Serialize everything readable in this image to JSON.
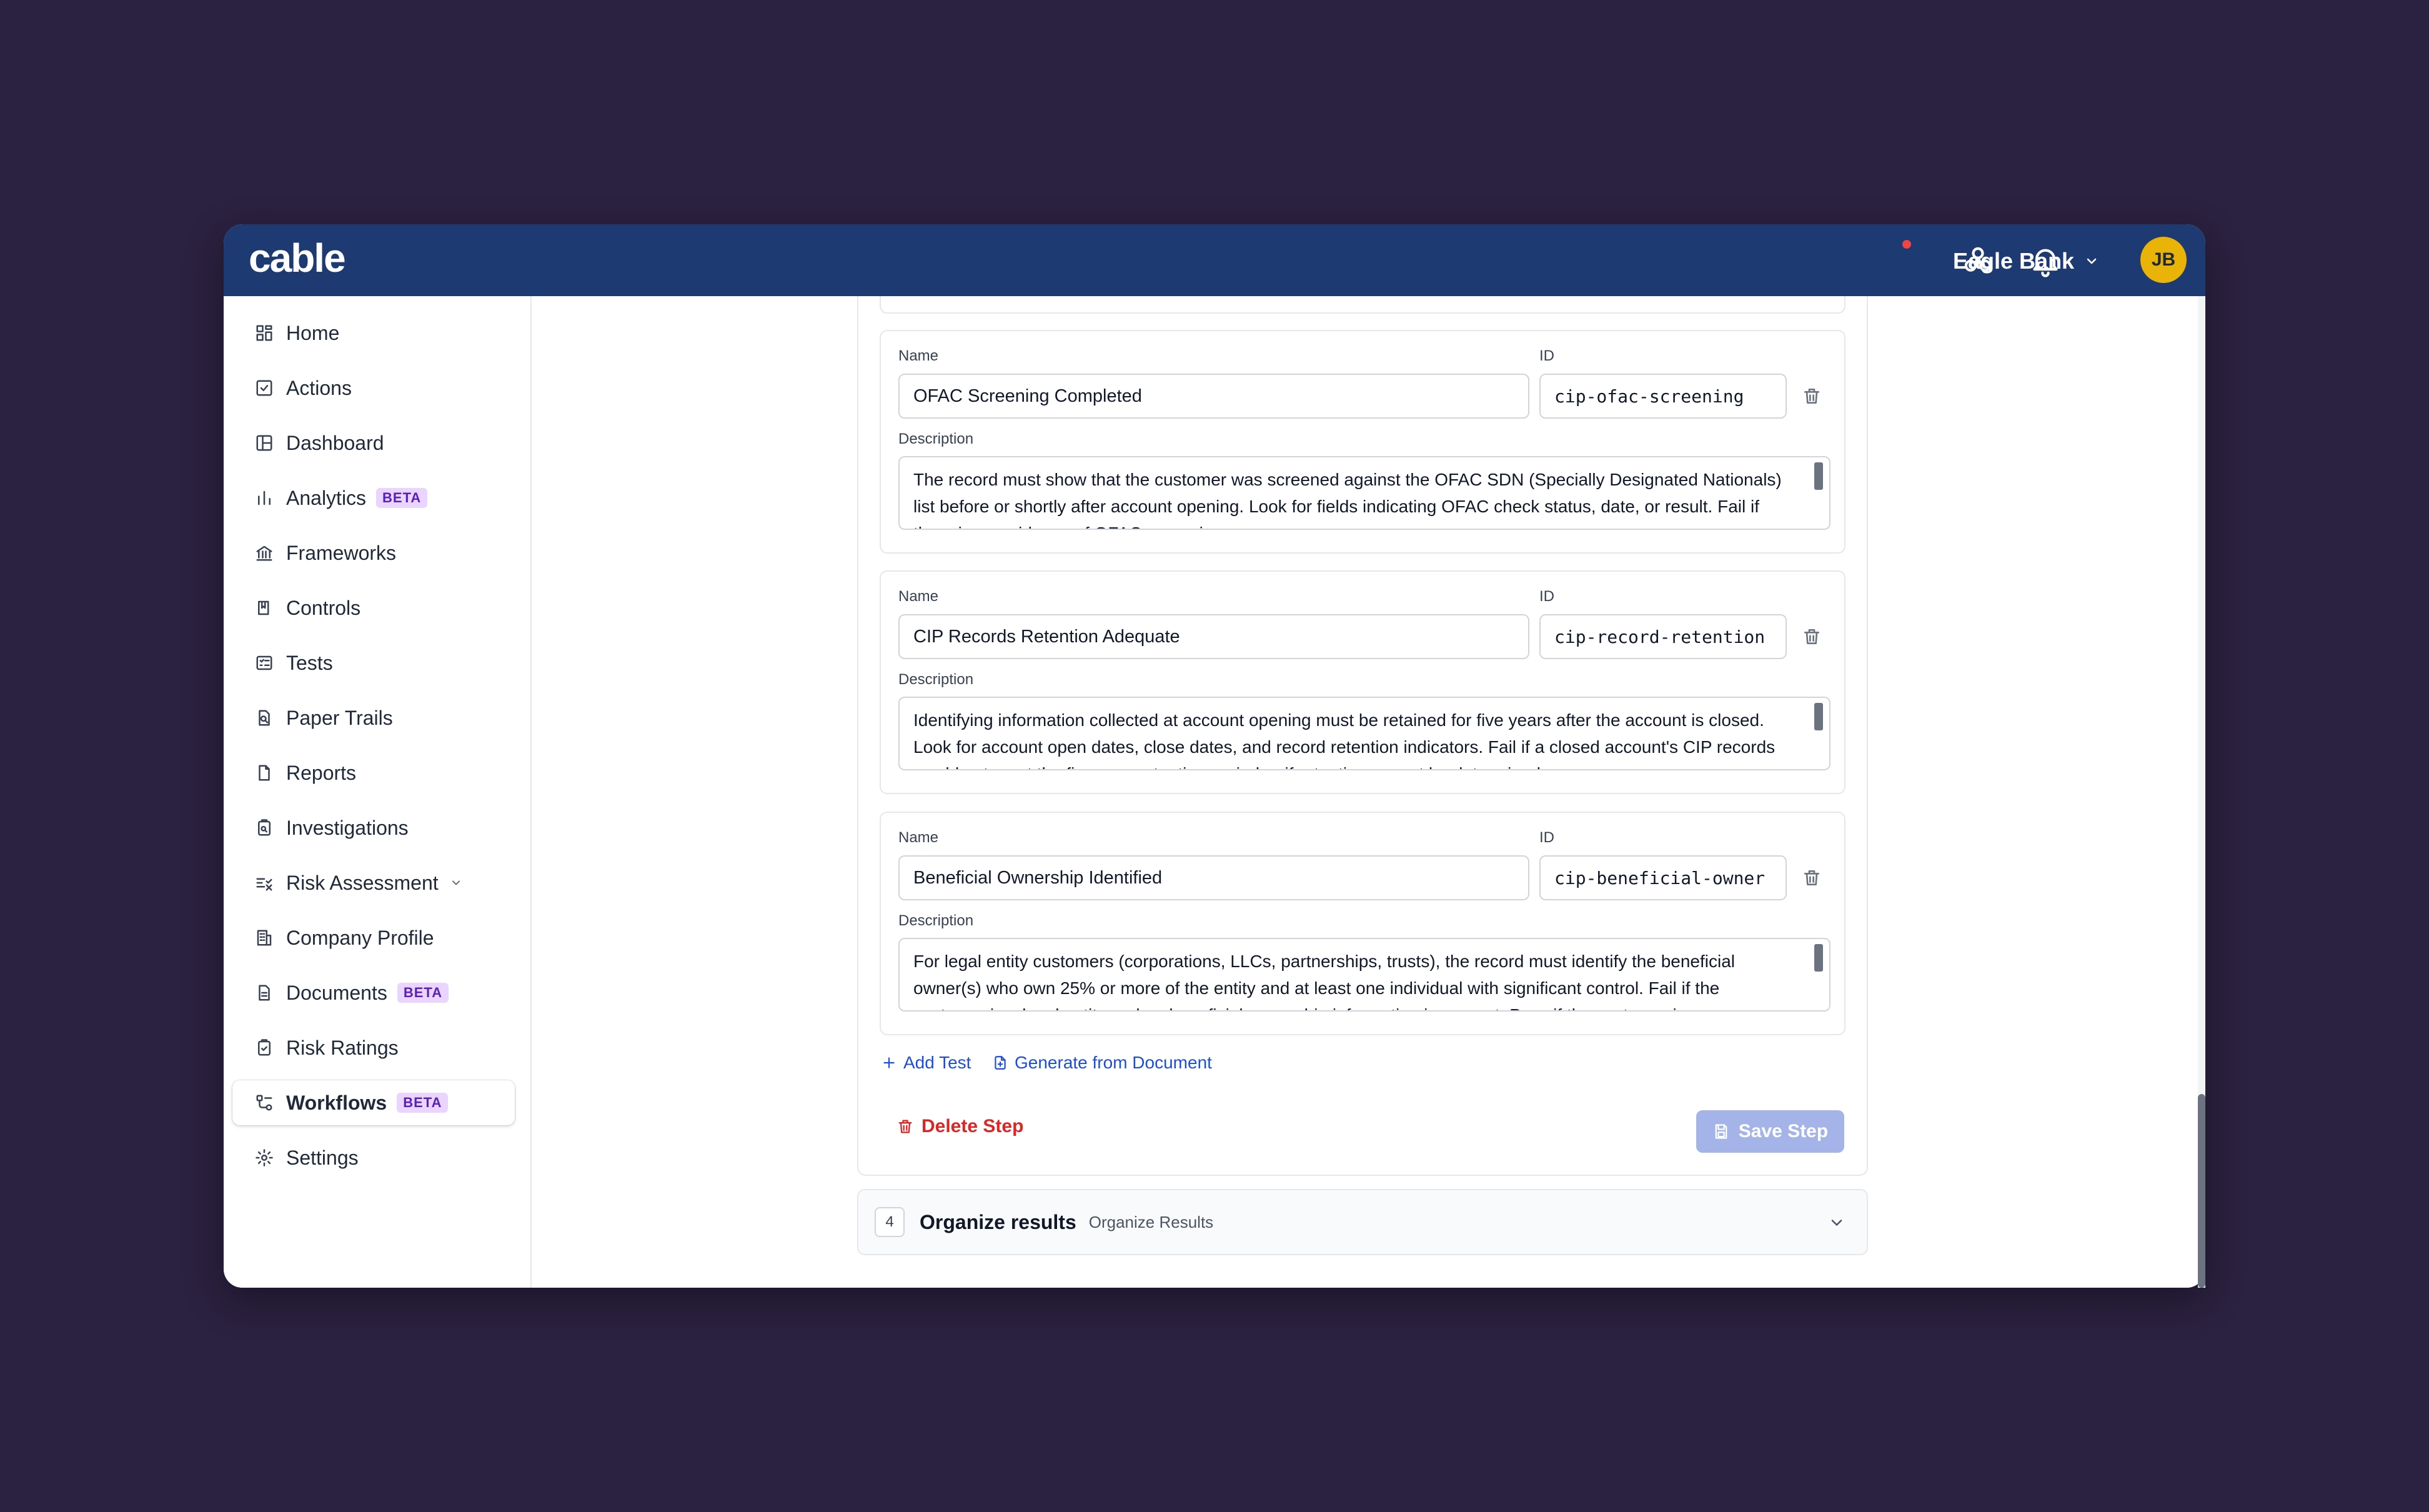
{
  "app": {
    "logo": "cable",
    "org_name": "Eagle Bank",
    "avatar_initials": "JB"
  },
  "sidebar": {
    "items": [
      {
        "label": "Home",
        "icon": "home-grid-icon"
      },
      {
        "label": "Actions",
        "icon": "checkbox-icon"
      },
      {
        "label": "Dashboard",
        "icon": "dashboard-icon"
      },
      {
        "label": "Analytics",
        "icon": "bar-chart-icon",
        "badge": "BETA"
      },
      {
        "label": "Frameworks",
        "icon": "bank-icon"
      },
      {
        "label": "Controls",
        "icon": "book-icon"
      },
      {
        "label": "Tests",
        "icon": "test-list-icon"
      },
      {
        "label": "Paper Trails",
        "icon": "file-search-icon"
      },
      {
        "label": "Reports",
        "icon": "file-icon"
      },
      {
        "label": "Investigations",
        "icon": "clipboard-search-icon"
      },
      {
        "label": "Risk Assessment",
        "icon": "list-check-icon"
      },
      {
        "label": "Company Profile",
        "icon": "building-icon"
      },
      {
        "label": "Documents",
        "icon": "document-icon",
        "badge": "BETA"
      },
      {
        "label": "Risk Ratings",
        "icon": "clipboard-check-icon"
      },
      {
        "label": "Workflows",
        "icon": "workflow-icon",
        "badge": "BETA",
        "active": true
      },
      {
        "label": "Settings",
        "icon": "gear-icon"
      }
    ]
  },
  "tests": [
    {
      "name_label": "Name",
      "name": "OFAC Screening Completed",
      "id_label": "ID",
      "id": "cip-ofac-screening",
      "description_label": "Description",
      "description": "The record must show that the customer was screened against the OFAC SDN (Specially Designated Nationals) list before or shortly after account opening. Look for fields indicating OFAC check status, date, or result. Fail if there is no evidence of OFAC screening."
    },
    {
      "name_label": "Name",
      "name": "CIP Records Retention Adequate",
      "id_label": "ID",
      "id": "cip-record-retention",
      "description_label": "Description",
      "description": "Identifying information collected at account opening must be retained for five years after the account is closed. Look for account open dates, close dates, and record retention indicators. Fail if a closed account's CIP records would not meet the five-year retention period or if retention cannot be determined."
    },
    {
      "name_label": "Name",
      "name": "Beneficial Ownership Identified",
      "id_label": "ID",
      "id": "cip-beneficial-owner",
      "description_label": "Description",
      "description": "For legal entity customers (corporations, LLCs, partnerships, trusts), the record must identify the beneficial owner(s) who own 25% or more of the entity and at least one individual with significant control. Fail if the customer is a legal entity and no beneficial ownership information is present. Pass if the customer is an individual."
    }
  ],
  "actions": {
    "add_test": "Add Test",
    "generate_from_document": "Generate from Document",
    "delete_step": "Delete Step",
    "save_step": "Save Step"
  },
  "step4": {
    "number": "4",
    "title": "Organize results",
    "subtitle": "Organize Results"
  }
}
